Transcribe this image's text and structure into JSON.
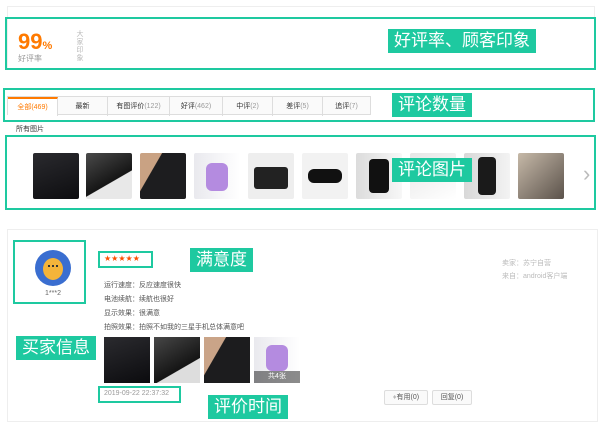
{
  "summary": {
    "rate": "99",
    "rate_unit": "%",
    "rate_label": "好评率",
    "impression_vertical": "大家印象"
  },
  "tabs": [
    {
      "label": "全部",
      "count": "(469)",
      "active": true
    },
    {
      "label": "最新",
      "count": "",
      "active": false
    },
    {
      "label": "有图评价",
      "count": "(122)",
      "active": false
    },
    {
      "label": "好评",
      "count": "(462)",
      "active": false
    },
    {
      "label": "中评",
      "count": "(2)",
      "active": false
    },
    {
      "label": "差评",
      "count": "(5)",
      "active": false
    },
    {
      "label": "追评",
      "count": "(7)",
      "active": false
    }
  ],
  "gallery": {
    "label": "所有图片",
    "next_glyph": "›"
  },
  "review": {
    "username": "1***2",
    "stars": "★★★★★",
    "lines": [
      "运行速度：反应速度很快",
      "电池续航：续航也很好",
      "显示效果：很满意",
      "拍照效果：拍照不如我的三星手机总体满意吧"
    ],
    "photo_count_badge": "共4张",
    "timestamp": "2019-09-22 22:37:32",
    "seller": "卖家：苏宁自营",
    "source": "来自：android客户端",
    "useful_button": "有用(0)",
    "reply_button": "回复(0)"
  },
  "annotations": {
    "rating_impression": "好评率、顾客印象",
    "review_count": "评论数量",
    "review_photos": "评论图片",
    "satisfaction": "满意度",
    "buyer_info": "买家信息",
    "review_time": "评价时间"
  },
  "colors": {
    "annotation": "#1ec9a0",
    "accent": "#ff7a00",
    "star": "#ff4e00"
  }
}
